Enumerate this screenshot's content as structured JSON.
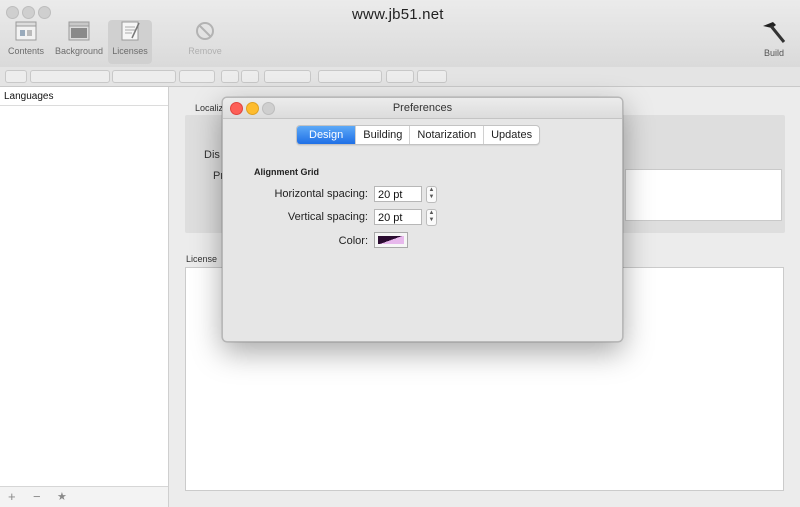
{
  "watermark": "www.jb51.net",
  "toolbar": {
    "items": [
      {
        "label": "Contents"
      },
      {
        "label": "Background"
      },
      {
        "label": "Licenses"
      },
      {
        "label": "Remove"
      },
      {
        "label": "Build"
      }
    ]
  },
  "sidebar": {
    "header": "Languages",
    "footer": {
      "add": "+",
      "remove": "−",
      "star": "★"
    }
  },
  "main": {
    "localization_label": "Localiz",
    "dis_label": "Dis",
    "pr_label": "Pr",
    "license_label": "License"
  },
  "dialog": {
    "title": "Preferences",
    "tabs": [
      {
        "label": "Design",
        "active": true
      },
      {
        "label": "Building",
        "active": false
      },
      {
        "label": "Notarization",
        "active": false
      },
      {
        "label": "Updates",
        "active": false
      }
    ],
    "section_title": "Alignment Grid",
    "horizontal_label": "Horizontal spacing:",
    "horizontal_value": "20 pt",
    "vertical_label": "Vertical spacing:",
    "vertical_value": "20 pt",
    "color_label": "Color:",
    "color_value": "#2a0b30"
  },
  "colors": {
    "accent": "#1f6fe6",
    "close": "#fd5f57",
    "minimize": "#febc2e"
  }
}
